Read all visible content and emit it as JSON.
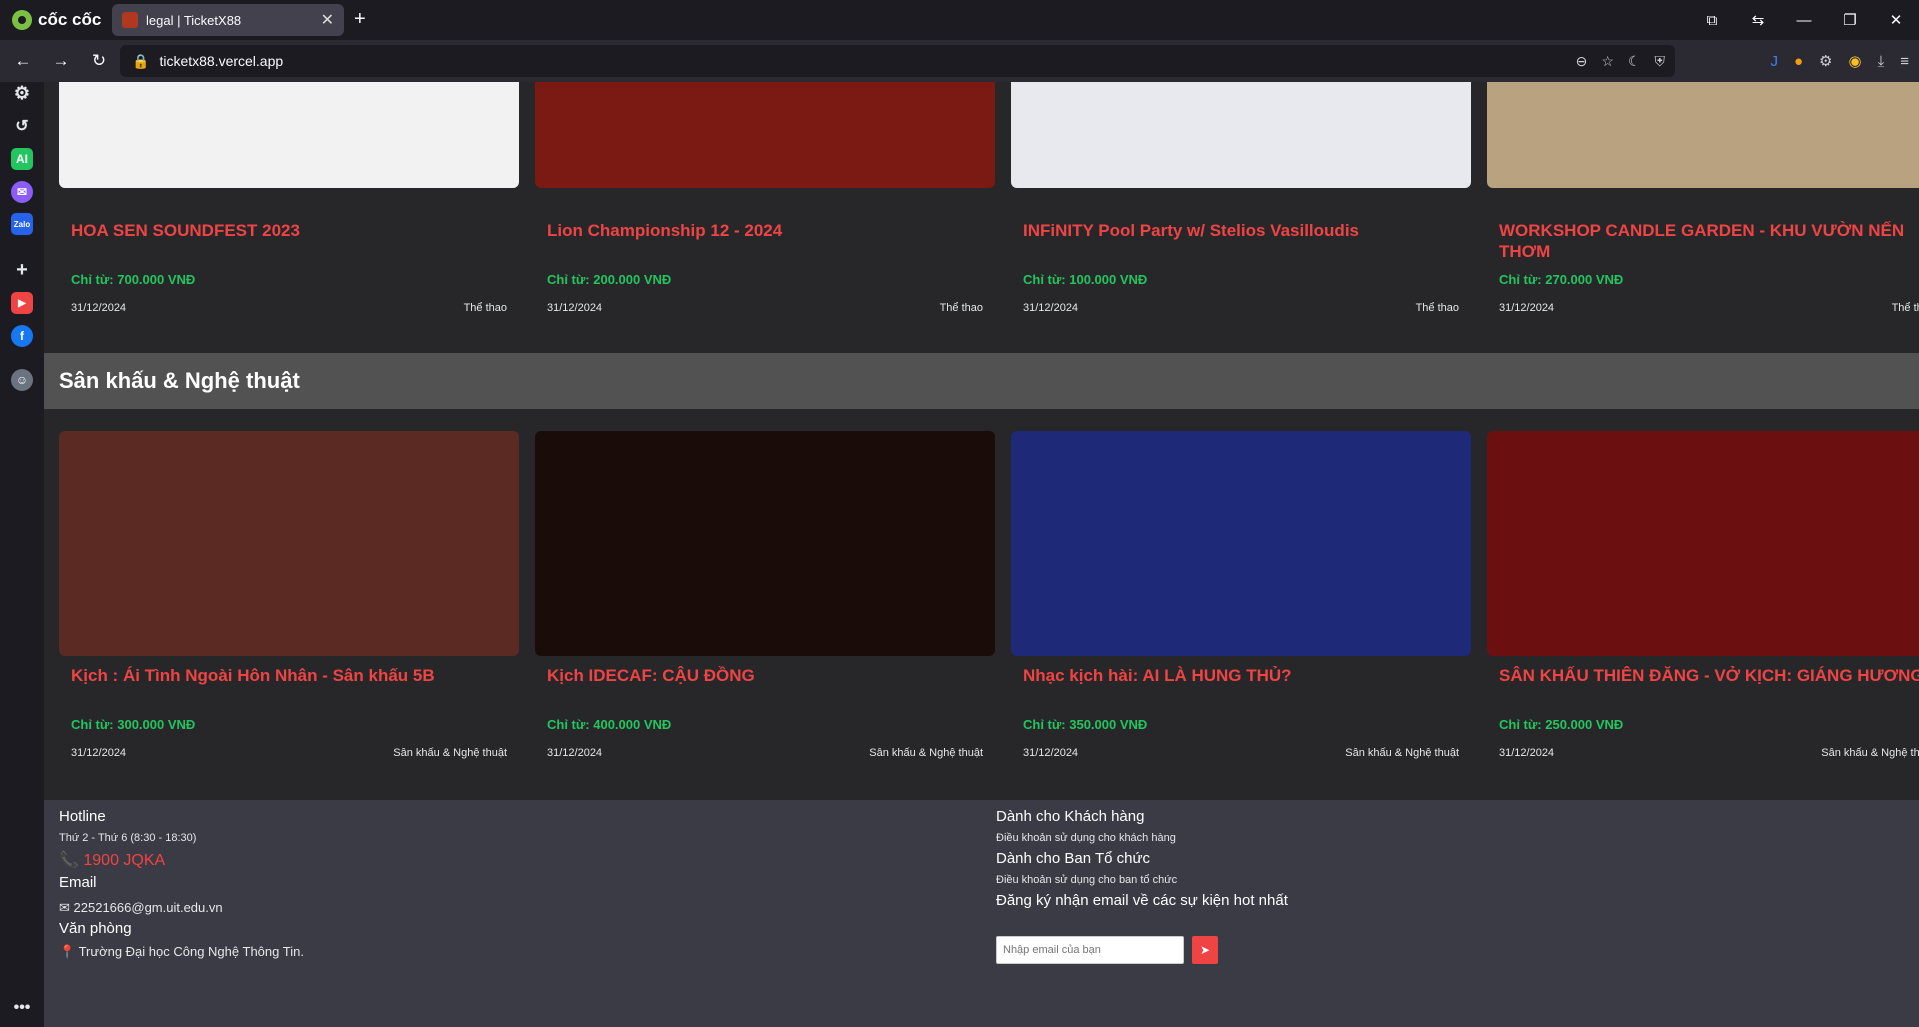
{
  "browser": {
    "brand": "cốc cốc",
    "tab_title": "legal | TicketX88",
    "url": "ticketx88.vercel.app"
  },
  "section": {
    "title": "Sân khấu & Nghệ thuật"
  },
  "top_events": [
    {
      "title": "HOA SEN SOUNDFEST 2023",
      "price": "Chỉ từ: 700.000 VNĐ",
      "date": "31/12/2024",
      "category": "Thể thao",
      "image_color": "#f2f2f2"
    },
    {
      "title": "Lion Championship 12 - 2024",
      "price": "Chỉ từ: 200.000 VNĐ",
      "date": "31/12/2024",
      "category": "Thể thao",
      "image_color": "#7a1a12"
    },
    {
      "title": "INFiNITY Pool Party w/ Stelios Vasilloudis",
      "price": "Chỉ từ: 100.000 VNĐ",
      "date": "31/12/2024",
      "category": "Thể thao",
      "image_color": "#e8e8ef"
    },
    {
      "title": "WORKSHOP CANDLE GARDEN - KHU VƯỜN NẾN THƠM",
      "price": "Chỉ từ: 270.000 VNĐ",
      "date": "31/12/2024",
      "category": "Thể thao",
      "image_color": "#b9a27f"
    }
  ],
  "art_events": [
    {
      "title": "Kịch : Ái Tình Ngoài Hôn Nhân - Sân khấu 5B",
      "price": "Chỉ từ: 300.000 VNĐ",
      "date": "31/12/2024",
      "category": "Sân khấu & Nghệ thuật",
      "image_color": "#5b2a22"
    },
    {
      "title": "Kịch IDECAF: CẬU ĐỒNG",
      "price": "Chỉ từ: 400.000 VNĐ",
      "date": "31/12/2024",
      "category": "Sân khấu & Nghệ thuật",
      "image_color": "#1a0c08"
    },
    {
      "title": "Nhạc kịch hài: AI LÀ HUNG THỦ?",
      "price": "Chỉ từ: 350.000 VNĐ",
      "date": "31/12/2024",
      "category": "Sân khấu & Nghệ thuật",
      "image_color": "#1e2a78"
    },
    {
      "title": "SÂN KHẤU THIÊN ĐĂNG - VỞ KỊCH: GIÁNG HƯƠNG",
      "price": "Chỉ từ: 250.000 VNĐ",
      "date": "31/12/2024",
      "category": "Sân khấu & Nghệ thuật",
      "image_color": "#6b0f10"
    }
  ],
  "footer": {
    "hotline_title": "Hotline",
    "hotline_hours": "Thứ 2 - Thứ 6 (8:30 - 18:30)",
    "hotline_number": "1900 JQKA",
    "email_title": "Email",
    "email_value": "22521666@gm.uit.edu.vn",
    "office_title": "Văn phòng",
    "office_value": "Trường Đại học Công Nghệ Thông Tin.",
    "customer_title": "Dành cho Khách hàng",
    "customer_link": "Điều khoản sử dụng cho khách hàng",
    "organizer_title": "Dành cho Ban Tổ chức",
    "organizer_link": "Điều khoản sử dụng cho ban tổ chức",
    "subscribe_title": "Đăng ký nhận email về các sự kiện hot nhất",
    "subscribe_placeholder": "Nhập email của bạn"
  }
}
